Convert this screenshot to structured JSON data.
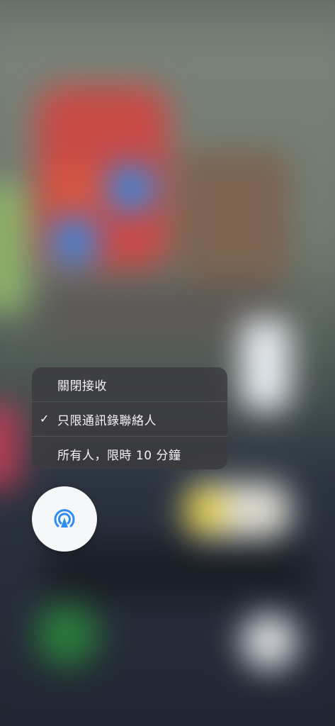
{
  "airdrop_menu": {
    "items": [
      {
        "label": "關閉接收",
        "checked": false
      },
      {
        "label": "只限通訊錄聯絡人",
        "checked": true
      },
      {
        "label": "所有人，限時 10 分鐘",
        "checked": false
      }
    ],
    "check_mark": "✓"
  },
  "airdrop_button": {
    "icon": "airdrop-icon",
    "accent_color": "#2f8cf0"
  }
}
